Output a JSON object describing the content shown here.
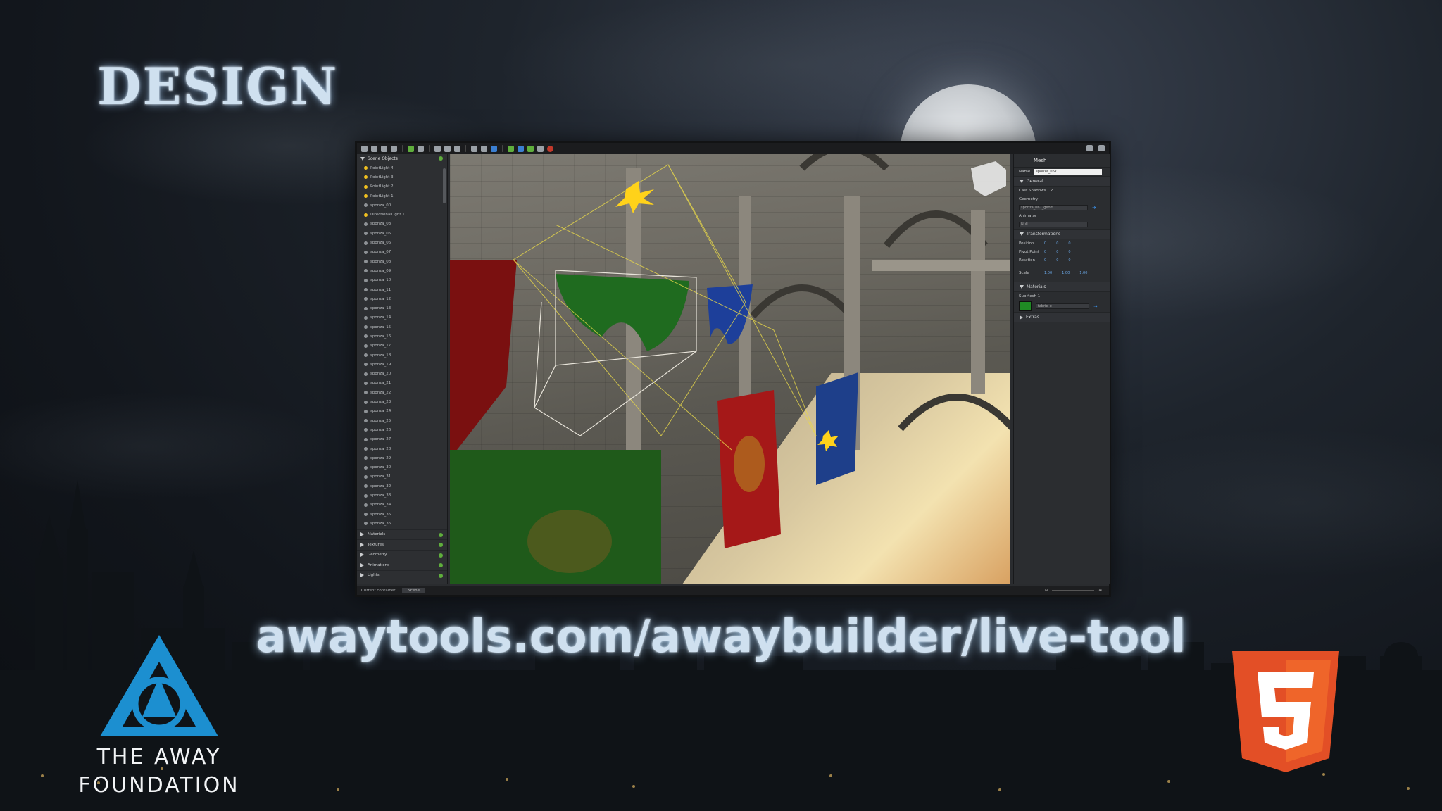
{
  "slide": {
    "title": "DESIGN",
    "url": "awaytools.com/awaybuilder/live-tool",
    "logo_left_line1": "THE AWAY",
    "logo_left_line2": "FOUNDATION",
    "logo_right_icon": "html5-logo"
  },
  "app": {
    "toolbar_icons": [
      "new-icon",
      "open-icon",
      "save-icon",
      "save-as-icon",
      "undo-icon",
      "redo-icon",
      "cut-icon",
      "copy-icon",
      "paste-icon",
      "eye-icon",
      "select-icon",
      "move-icon",
      "rotate-icon",
      "scale-icon",
      "snap-icon",
      "delete-icon"
    ],
    "outliner": {
      "header": "Scene Objects",
      "items": [
        {
          "label": "PointLight 4",
          "type": "light"
        },
        {
          "label": "PointLight 3",
          "type": "light"
        },
        {
          "label": "PointLight 2",
          "type": "light"
        },
        {
          "label": "PointLight 1",
          "type": "light"
        },
        {
          "label": "sponza_00",
          "type": "mesh"
        },
        {
          "label": "DirectionalLight 1",
          "type": "light"
        },
        {
          "label": "sponza_03",
          "type": "mesh"
        },
        {
          "label": "sponza_05",
          "type": "mesh"
        },
        {
          "label": "sponza_06",
          "type": "mesh"
        },
        {
          "label": "sponza_07",
          "type": "mesh"
        },
        {
          "label": "sponza_08",
          "type": "mesh"
        },
        {
          "label": "sponza_09",
          "type": "mesh"
        },
        {
          "label": "sponza_10",
          "type": "mesh"
        },
        {
          "label": "sponza_11",
          "type": "mesh"
        },
        {
          "label": "sponza_12",
          "type": "mesh"
        },
        {
          "label": "sponza_13",
          "type": "mesh"
        },
        {
          "label": "sponza_14",
          "type": "mesh"
        },
        {
          "label": "sponza_15",
          "type": "mesh"
        },
        {
          "label": "sponza_16",
          "type": "mesh"
        },
        {
          "label": "sponza_17",
          "type": "mesh"
        },
        {
          "label": "sponza_18",
          "type": "mesh"
        },
        {
          "label": "sponza_19",
          "type": "mesh"
        },
        {
          "label": "sponza_20",
          "type": "mesh"
        },
        {
          "label": "sponza_21",
          "type": "mesh"
        },
        {
          "label": "sponza_22",
          "type": "mesh"
        },
        {
          "label": "sponza_23",
          "type": "mesh"
        },
        {
          "label": "sponza_24",
          "type": "mesh"
        },
        {
          "label": "sponza_25",
          "type": "mesh"
        },
        {
          "label": "sponza_26",
          "type": "mesh"
        },
        {
          "label": "sponza_27",
          "type": "mesh"
        },
        {
          "label": "sponza_28",
          "type": "mesh"
        },
        {
          "label": "sponza_29",
          "type": "mesh"
        },
        {
          "label": "sponza_30",
          "type": "mesh"
        },
        {
          "label": "sponza_31",
          "type": "mesh"
        },
        {
          "label": "sponza_32",
          "type": "mesh"
        },
        {
          "label": "sponza_33",
          "type": "mesh"
        },
        {
          "label": "sponza_34",
          "type": "mesh"
        },
        {
          "label": "sponza_35",
          "type": "mesh"
        },
        {
          "label": "sponza_36",
          "type": "mesh"
        }
      ],
      "categories": [
        "Materials",
        "Textures",
        "Geometry",
        "Animations",
        "Lights"
      ]
    },
    "inspector": {
      "title": "Mesh",
      "name_label": "Name",
      "name_value": "sponza_067",
      "general_label": "General",
      "cast_shadows_label": "Cast Shadows",
      "geometry_label": "Geometry",
      "geometry_value": "sponza_067_geom",
      "animator_label": "Animator",
      "animator_value": "Null",
      "transformations_label": "Transformations",
      "position_label": "Position",
      "pivot_label": "Pivot Point",
      "rotation_label": "Rotation",
      "scale_label": "Scale",
      "position": [
        "0",
        "0",
        "0"
      ],
      "pivot": [
        "0",
        "0",
        "0"
      ],
      "rotation": [
        "0",
        "0",
        "0"
      ],
      "scale": [
        "1.00",
        "1.00",
        "1.00"
      ],
      "materials_label": "Materials",
      "submesh_label": "SubMesh 1",
      "material_value": "fabric_e",
      "material_color": "#1f8a24",
      "extras_label": "Extras"
    },
    "statusbar": {
      "container_label": "Current container:",
      "container_value": "Scene"
    }
  }
}
